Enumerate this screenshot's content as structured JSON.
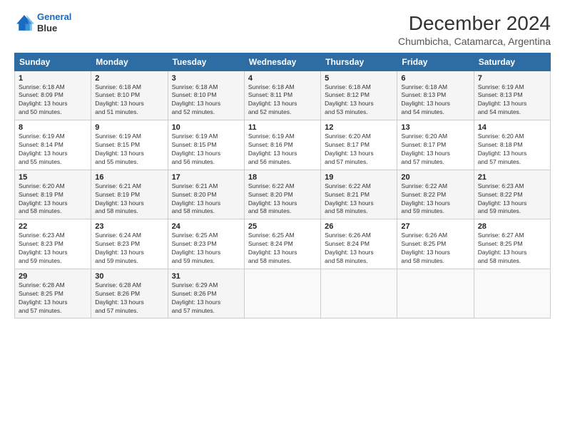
{
  "logo": {
    "line1": "General",
    "line2": "Blue"
  },
  "title": "December 2024",
  "subtitle": "Chumbicha, Catamarca, Argentina",
  "days_header": [
    "Sunday",
    "Monday",
    "Tuesday",
    "Wednesday",
    "Thursday",
    "Friday",
    "Saturday"
  ],
  "weeks": [
    [
      {
        "day": "1",
        "info": "Sunrise: 6:18 AM\nSunset: 8:09 PM\nDaylight: 13 hours\nand 50 minutes."
      },
      {
        "day": "2",
        "info": "Sunrise: 6:18 AM\nSunset: 8:10 PM\nDaylight: 13 hours\nand 51 minutes."
      },
      {
        "day": "3",
        "info": "Sunrise: 6:18 AM\nSunset: 8:10 PM\nDaylight: 13 hours\nand 52 minutes."
      },
      {
        "day": "4",
        "info": "Sunrise: 6:18 AM\nSunset: 8:11 PM\nDaylight: 13 hours\nand 52 minutes."
      },
      {
        "day": "5",
        "info": "Sunrise: 6:18 AM\nSunset: 8:12 PM\nDaylight: 13 hours\nand 53 minutes."
      },
      {
        "day": "6",
        "info": "Sunrise: 6:18 AM\nSunset: 8:13 PM\nDaylight: 13 hours\nand 54 minutes."
      },
      {
        "day": "7",
        "info": "Sunrise: 6:19 AM\nSunset: 8:13 PM\nDaylight: 13 hours\nand 54 minutes."
      }
    ],
    [
      {
        "day": "8",
        "info": "Sunrise: 6:19 AM\nSunset: 8:14 PM\nDaylight: 13 hours\nand 55 minutes."
      },
      {
        "day": "9",
        "info": "Sunrise: 6:19 AM\nSunset: 8:15 PM\nDaylight: 13 hours\nand 55 minutes."
      },
      {
        "day": "10",
        "info": "Sunrise: 6:19 AM\nSunset: 8:15 PM\nDaylight: 13 hours\nand 56 minutes."
      },
      {
        "day": "11",
        "info": "Sunrise: 6:19 AM\nSunset: 8:16 PM\nDaylight: 13 hours\nand 56 minutes."
      },
      {
        "day": "12",
        "info": "Sunrise: 6:20 AM\nSunset: 8:17 PM\nDaylight: 13 hours\nand 57 minutes."
      },
      {
        "day": "13",
        "info": "Sunrise: 6:20 AM\nSunset: 8:17 PM\nDaylight: 13 hours\nand 57 minutes."
      },
      {
        "day": "14",
        "info": "Sunrise: 6:20 AM\nSunset: 8:18 PM\nDaylight: 13 hours\nand 57 minutes."
      }
    ],
    [
      {
        "day": "15",
        "info": "Sunrise: 6:20 AM\nSunset: 8:19 PM\nDaylight: 13 hours\nand 58 minutes."
      },
      {
        "day": "16",
        "info": "Sunrise: 6:21 AM\nSunset: 8:19 PM\nDaylight: 13 hours\nand 58 minutes."
      },
      {
        "day": "17",
        "info": "Sunrise: 6:21 AM\nSunset: 8:20 PM\nDaylight: 13 hours\nand 58 minutes."
      },
      {
        "day": "18",
        "info": "Sunrise: 6:22 AM\nSunset: 8:20 PM\nDaylight: 13 hours\nand 58 minutes."
      },
      {
        "day": "19",
        "info": "Sunrise: 6:22 AM\nSunset: 8:21 PM\nDaylight: 13 hours\nand 58 minutes."
      },
      {
        "day": "20",
        "info": "Sunrise: 6:22 AM\nSunset: 8:22 PM\nDaylight: 13 hours\nand 59 minutes."
      },
      {
        "day": "21",
        "info": "Sunrise: 6:23 AM\nSunset: 8:22 PM\nDaylight: 13 hours\nand 59 minutes."
      }
    ],
    [
      {
        "day": "22",
        "info": "Sunrise: 6:23 AM\nSunset: 8:23 PM\nDaylight: 13 hours\nand 59 minutes."
      },
      {
        "day": "23",
        "info": "Sunrise: 6:24 AM\nSunset: 8:23 PM\nDaylight: 13 hours\nand 59 minutes."
      },
      {
        "day": "24",
        "info": "Sunrise: 6:25 AM\nSunset: 8:23 PM\nDaylight: 13 hours\nand 59 minutes."
      },
      {
        "day": "25",
        "info": "Sunrise: 6:25 AM\nSunset: 8:24 PM\nDaylight: 13 hours\nand 58 minutes."
      },
      {
        "day": "26",
        "info": "Sunrise: 6:26 AM\nSunset: 8:24 PM\nDaylight: 13 hours\nand 58 minutes."
      },
      {
        "day": "27",
        "info": "Sunrise: 6:26 AM\nSunset: 8:25 PM\nDaylight: 13 hours\nand 58 minutes."
      },
      {
        "day": "28",
        "info": "Sunrise: 6:27 AM\nSunset: 8:25 PM\nDaylight: 13 hours\nand 58 minutes."
      }
    ],
    [
      {
        "day": "29",
        "info": "Sunrise: 6:28 AM\nSunset: 8:25 PM\nDaylight: 13 hours\nand 57 minutes."
      },
      {
        "day": "30",
        "info": "Sunrise: 6:28 AM\nSunset: 8:26 PM\nDaylight: 13 hours\nand 57 minutes."
      },
      {
        "day": "31",
        "info": "Sunrise: 6:29 AM\nSunset: 8:26 PM\nDaylight: 13 hours\nand 57 minutes."
      },
      {
        "day": "",
        "info": ""
      },
      {
        "day": "",
        "info": ""
      },
      {
        "day": "",
        "info": ""
      },
      {
        "day": "",
        "info": ""
      }
    ]
  ]
}
